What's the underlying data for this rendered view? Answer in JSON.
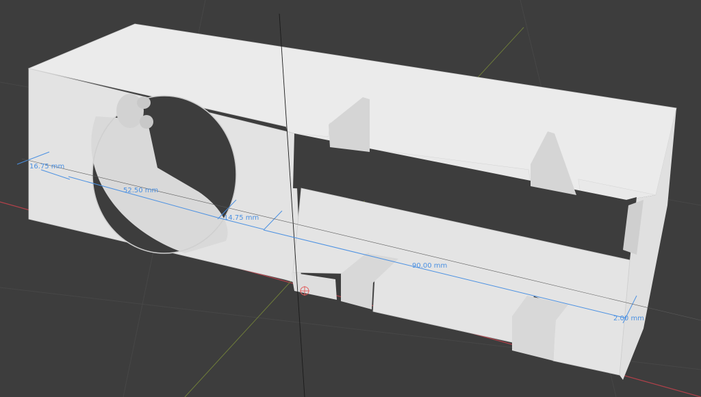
{
  "viewport": {
    "background": "#3d3d3d",
    "model_color": "#e6e6e6",
    "dimension_color": "#4a90e2",
    "axis_x_color": "#b3414a",
    "axis_y_color": "#6f7d3a"
  },
  "dimensions": {
    "end_depth": "16.75 mm",
    "hole_width": "52.50 mm",
    "gap_width": "14.75 mm",
    "length": "90.00 mm",
    "wall_thickness": "2.00 mm"
  }
}
